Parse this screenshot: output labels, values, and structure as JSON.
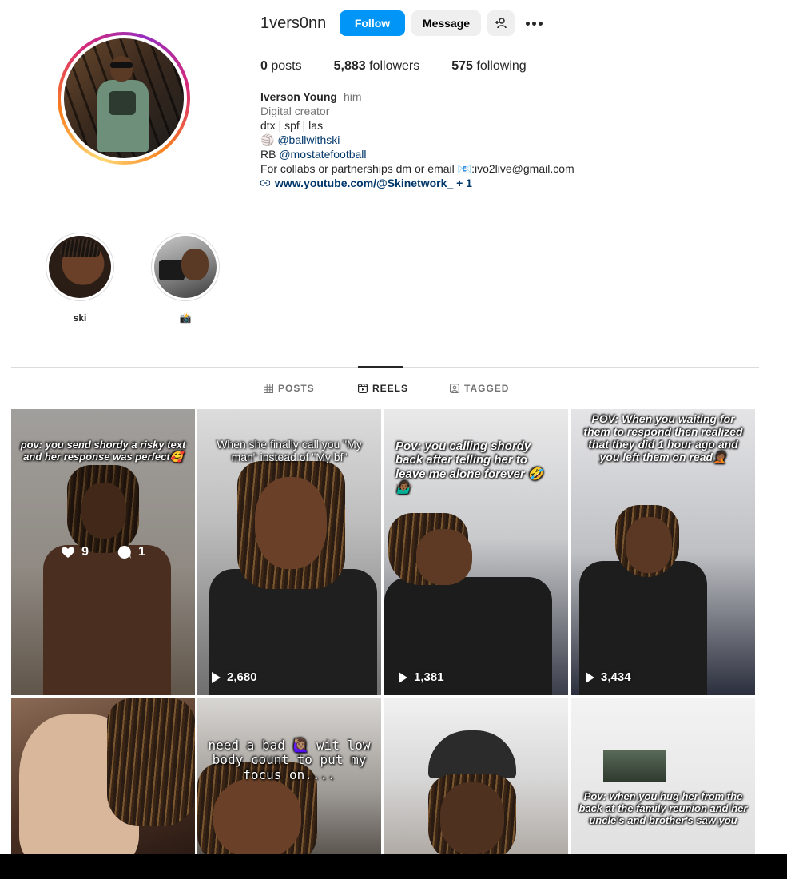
{
  "profile": {
    "username": "1vers0nn",
    "follow_label": "Follow",
    "message_label": "Message",
    "stats": {
      "posts_count": "0",
      "posts_label": "posts",
      "followers_count": "5,883",
      "followers_label": "followers",
      "following_count": "575",
      "following_label": "following"
    },
    "bio": {
      "name": "Iverson Young",
      "pronoun": "him",
      "category": "Digital creator",
      "line1": "dtx | spf | las",
      "line2_emoji": "🏐",
      "line2_mention": "@ballwithski",
      "line3_prefix": "RB",
      "line3_mention": "@mostatefootball",
      "line4": "For collabs or partnerships dm or email 📧:ivo2live@gmail.com",
      "link": "www.youtube.com/@Skinetwork_",
      "link_extra": "+ 1"
    }
  },
  "highlights": [
    {
      "label": "ski"
    },
    {
      "label": "📸"
    }
  ],
  "tabs": [
    {
      "label": "POSTS",
      "icon": "grid-icon"
    },
    {
      "label": "REELS",
      "icon": "reels-icon"
    },
    {
      "label": "TAGGED",
      "icon": "tagged-icon"
    }
  ],
  "reels": [
    {
      "caption": "pov: you send shordy a risky text and her response was perfect🥰",
      "likes": "9",
      "comments": "1"
    },
    {
      "caption": "When she finally call you \"My man\" instead of \"My bf\"",
      "plays": "2,680"
    },
    {
      "caption": "Pov: you calling shordy back after telling her to leave me alone forever 🤣🤷🏾‍♂️",
      "plays": "1,381"
    },
    {
      "caption": "POV: When you waiting for them to respond then realized that they did 1 hour ago and you left them on read🤦🏾",
      "plays": "3,434"
    },
    {
      "caption": ""
    },
    {
      "caption": "need a bad 🙋🏽‍♀️ wit low body count to put my focus on...."
    },
    {
      "caption": ""
    },
    {
      "caption": "Pov: when you hug her from the back at the family reunion and her uncle's and brother's saw you"
    }
  ],
  "colors": {
    "follow_blue": "#0095f6",
    "link_blue": "#00376b",
    "muted_gray": "#737373",
    "border_gray": "#dbdbdb"
  }
}
